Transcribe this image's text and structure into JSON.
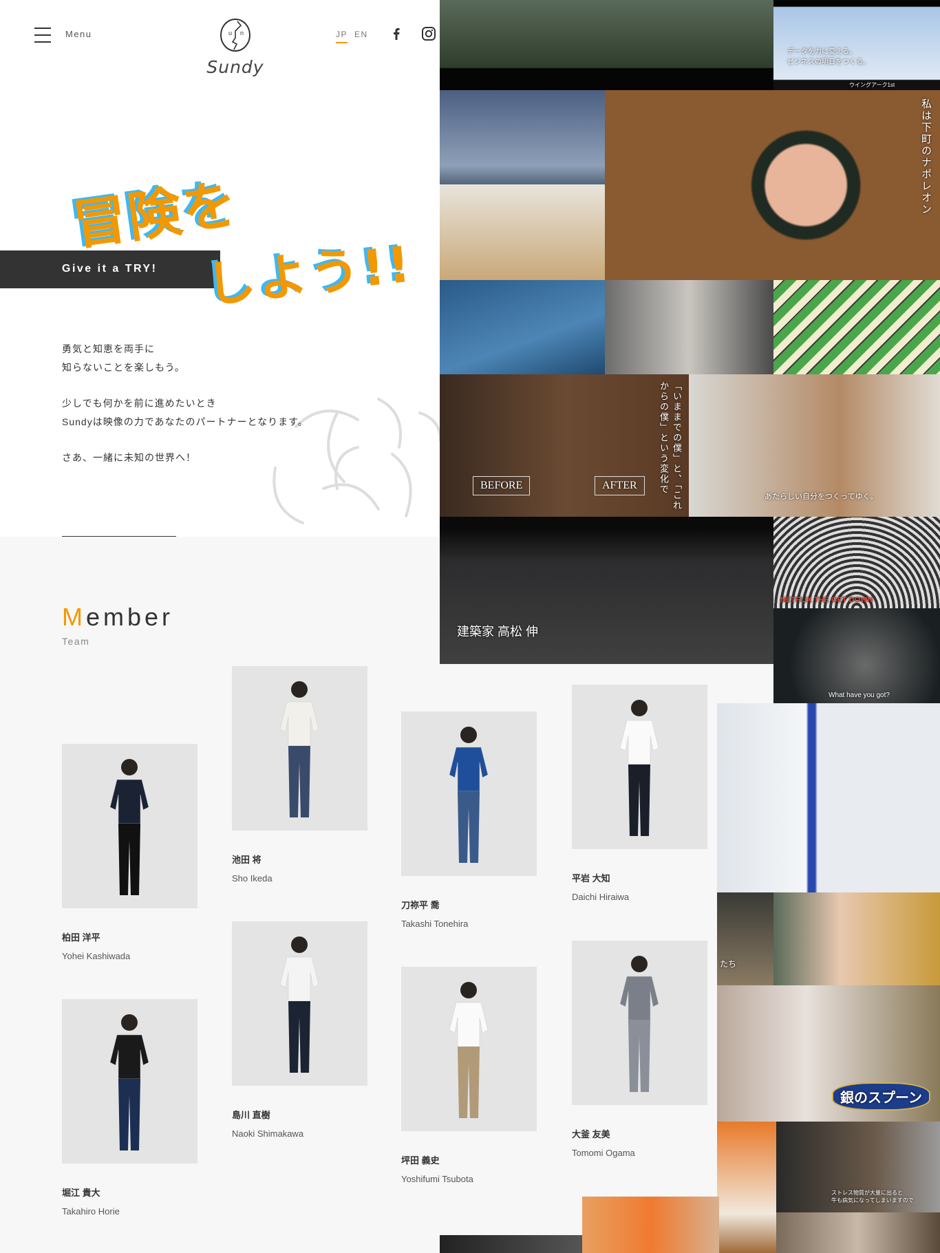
{
  "header": {
    "menu_label": "Menu",
    "logo_text": "Sundy",
    "lang": [
      {
        "label": "JP",
        "active": true
      },
      {
        "label": "EN",
        "active": false
      }
    ],
    "icons": [
      "menu-icon",
      "facebook-icon",
      "instagram-icon"
    ],
    "accent": "#f39800"
  },
  "hero": {
    "catch_line1": "冒険を",
    "catch_line2": "しよう!!",
    "tagline": "Give it a TRY!",
    "body": [
      "勇気と知恵を両手に",
      "知らないことを楽しもう。",
      "少しでも何かを前に進めたいとき",
      "Sundyは映像の力であなたのパートナーとなります。",
      "さあ、一緒に未知の世界へ！"
    ]
  },
  "member": {
    "title_initial": "M",
    "title_rest": "ember",
    "subtitle": "Team",
    "people": [
      {
        "jp": "柏田 洋平",
        "en": "Yohei Kashiwada",
        "shirt": "#1a2233",
        "pants": "#111"
      },
      {
        "jp": "池田 将",
        "en": "Sho Ikeda",
        "shirt": "#f2f0ea",
        "pants": "#3a4a6a"
      },
      {
        "jp": "刀祢平 喬",
        "en": "Takashi Tonehira",
        "shirt": "#1f4f9a",
        "pants": "#3a5a8a"
      },
      {
        "jp": "平岩 大知",
        "en": "Daichi Hiraiwa",
        "shirt": "#fafafa",
        "pants": "#1a1f2a"
      },
      {
        "jp": "堀江 貴大",
        "en": "Takahiro Horie",
        "shirt": "#1a1a1a",
        "pants": "#1c2f52"
      },
      {
        "jp": "島川 直樹",
        "en": "Naoki Shimakawa",
        "shirt": "#f4f4f4",
        "pants": "#1c2333"
      },
      {
        "jp": "坪田 義史",
        "en": "Yoshifumi Tsubota",
        "shirt": "#fafafa",
        "pants": "#b09a78"
      },
      {
        "jp": "大釜 友美",
        "en": "Tomomi Ogama",
        "shirt": "#7a7f8a",
        "pants": "#8a8f99"
      }
    ]
  },
  "works": [
    {
      "caption": ""
    },
    {
      "caption": "データを力に変える。\nビジネスの明日をつくる。",
      "sub": "ウイングアーク1st"
    },
    {
      "caption": ""
    },
    {
      "caption": ""
    },
    {
      "caption": "私は下町のナポレオン"
    },
    {
      "caption": ""
    },
    {
      "caption": ""
    },
    {
      "caption": ""
    },
    {
      "caption": "「いままでの僕」と、「これからの僕」という変化で",
      "before": "BEFORE",
      "after": "AFTER"
    },
    {
      "caption": "あたらしい自分をつくってゆく。"
    },
    {
      "caption": "建築家 高松 伸"
    },
    {
      "caption": "NETFLIX  THE GET DOWN"
    },
    {
      "caption": "What have you got?"
    },
    {
      "caption": ""
    },
    {
      "caption": "たち"
    },
    {
      "caption": ""
    },
    {
      "caption": "銀のスプーン"
    },
    {
      "caption": ""
    },
    {
      "caption": "ストレス物質が大量に出ると\n牛も病気になってしまいますので"
    },
    {
      "caption": ""
    },
    {
      "caption": ""
    },
    {
      "caption": ""
    }
  ]
}
